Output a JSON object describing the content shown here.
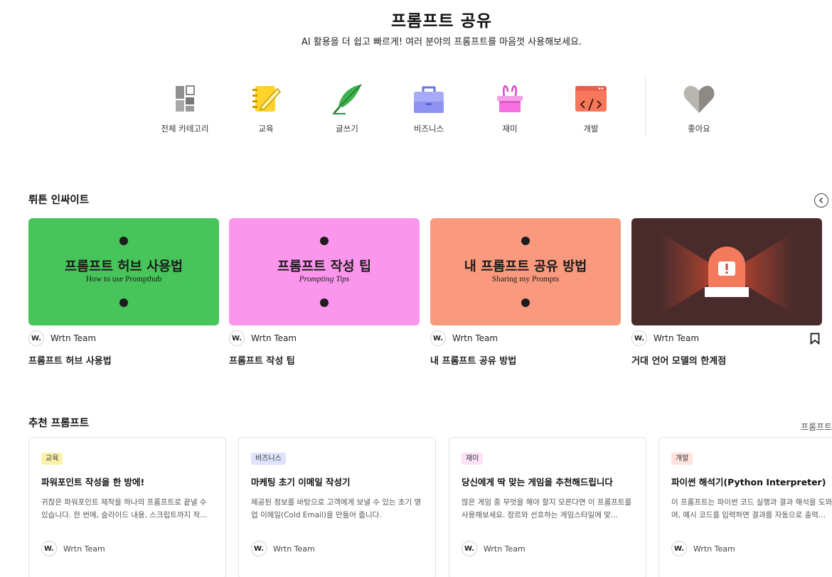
{
  "header": {
    "title": "프롬프트 공유",
    "subtitle": "AI 활용을 더 쉽고 빠르게! 여러 분야의 프롬프트를 마음껏 사용해보세요."
  },
  "categories": [
    {
      "label": "전체 카테고리",
      "icon": "grid-icon"
    },
    {
      "label": "교육",
      "icon": "notebook-pencil-icon"
    },
    {
      "label": "글쓰기",
      "icon": "feather-pen-icon"
    },
    {
      "label": "비즈니스",
      "icon": "briefcase-icon"
    },
    {
      "label": "재미",
      "icon": "bunny-hat-icon"
    },
    {
      "label": "개발",
      "icon": "code-window-icon"
    },
    {
      "label": "좋아요",
      "icon": "heart-icon"
    }
  ],
  "insights": {
    "title": "뤼튼 인싸이트",
    "cards": [
      {
        "thumb_title": "프롬프트 허브 사용법",
        "thumb_sub": "How to use Prompthub",
        "author": "Wrtn Team",
        "title": "프롬프트 허브 사용법",
        "color": "#47c45a"
      },
      {
        "thumb_title": "프롬프트 작성 팁",
        "thumb_sub": "Prompting Tips",
        "author": "Wrtn Team",
        "title": "프롬프트 작성 팁",
        "color": "#fb96ec"
      },
      {
        "thumb_title": "내 프롬프트 공유 방법",
        "thumb_sub": "Sharing my Prompts",
        "author": "Wrtn Team",
        "title": "내 프롬프트 공유 방법",
        "color": "#f99a7e"
      },
      {
        "author": "Wrtn Team",
        "title": "거대 언어 모델의 한계점",
        "color": "#4a2b2c",
        "icon": "warning-siren-icon"
      }
    ]
  },
  "recommended": {
    "title": "추천 프롬프트",
    "more_label": "프롬프트",
    "cards": [
      {
        "tag": "교육",
        "tag_color": "#fbf0a8",
        "title": "파워포인트 작성을 한 방에!",
        "desc": "귀찮은 파워포인트 제작을 하나의 프롬프트로 끝낼 수 있습니다. 한 번에, 슬라이드 내용, 스크립트까지 작...",
        "author": "Wrtn Team"
      },
      {
        "tag": "비즈니스",
        "tag_color": "#dfe2fb",
        "title": "마케팅 초기 이메일 작성기",
        "desc": "제공된 정보를 바탕으로 고객에게 보낼 수 있는 초기 영업 이메일(Cold Email)을 만들어 줍니다.",
        "author": "Wrtn Team"
      },
      {
        "tag": "재미",
        "tag_color": "#fbe2f6",
        "title": "당신에게 딱 맞는 게임을 추천해드립니다",
        "desc": "많은 게임 중 무엇을 해야 할지 모른다면 이 프롬프트를 사용해보세요. 장르와 선호하는 게임스타일에 맞...",
        "author": "Wrtn Team"
      },
      {
        "tag": "개발",
        "tag_color": "#fde3dc",
        "title": "파이썬 해석기(Python Interpreter)",
        "desc": "이 프롬프트는 파이썬 코드 실행과 결과 해석을 도와주며, 예시 코드를 입력하면 결과를 자동으로 출력...",
        "author": "Wrtn Team"
      }
    ]
  },
  "avatar_text": "W."
}
